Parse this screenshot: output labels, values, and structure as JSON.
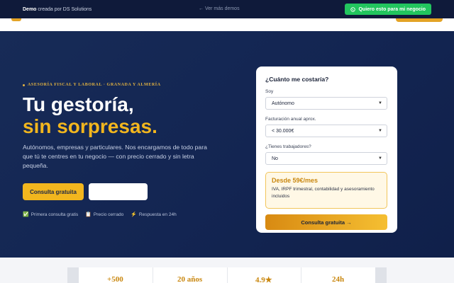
{
  "demo_bar": {
    "brand": "Demo",
    "brand_suffix": " creada por DS Solutions",
    "back_link": "← Ver más demos",
    "cta_label": "Quiero esto para mi negocio",
    "cta_color": "#22c55e"
  },
  "hero": {
    "eyebrow": "ASESORÍA FISCAL Y LABORAL · GRANADA Y ALMERÍA",
    "title_line1": "Tu gestoría,",
    "title_line2": "sin sorpresas.",
    "subtitle": "Autónomos, empresas y particulares. Nos encargamos de todo para que tú te centres en tu negocio — con precio cerrado y sin letra pequeña.",
    "primary_button": "Consulta gratuita",
    "secondary_button": "",
    "trust": [
      {
        "icon": "check-icon",
        "glyph": "✅",
        "label": "Primera consulta gratis"
      },
      {
        "icon": "clipboard-icon",
        "glyph": "📋",
        "label": "Precio cerrado"
      },
      {
        "icon": "lightning-icon",
        "glyph": "⚡",
        "label": "Respuesta en 24h"
      }
    ],
    "accent_color": "#f2b61e"
  },
  "quote_card": {
    "title": "¿Cuánto me costaría?",
    "fields": [
      {
        "label": "Soy",
        "value": "Autónomo"
      },
      {
        "label": "Facturación anual aprox.",
        "value": "< 30.000€"
      },
      {
        "label": "¿Tienes trabajadores?",
        "value": "No"
      }
    ],
    "price": "Desde 59€/mes",
    "includes": "IVA, IRPF trimestral, contabilidad y asesoramiento incluidos",
    "cta": "Consulta gratuita →"
  },
  "stats": [
    "+500",
    "20 años",
    "4.9★",
    "24h"
  ]
}
